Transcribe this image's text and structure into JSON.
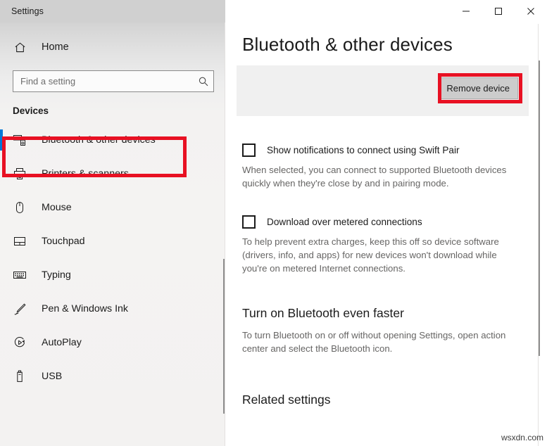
{
  "window": {
    "title": "Settings",
    "controls": [
      {
        "name": "minimize",
        "glyph": "minimize-icon"
      },
      {
        "name": "maximize",
        "glyph": "maximize-icon"
      },
      {
        "name": "close",
        "glyph": "close-icon"
      }
    ]
  },
  "sidebar": {
    "home_label": "Home",
    "home_icon": "home-icon",
    "search": {
      "placeholder": "Find a setting",
      "value": "",
      "icon": "search-icon"
    },
    "group_title": "Devices",
    "items": [
      {
        "label": "Bluetooth & other devices",
        "icon": "bluetooth-devices-icon",
        "selected": true
      },
      {
        "label": "Printers & scanners",
        "icon": "printer-icon",
        "selected": false
      },
      {
        "label": "Mouse",
        "icon": "mouse-icon",
        "selected": false
      },
      {
        "label": "Touchpad",
        "icon": "touchpad-icon",
        "selected": false
      },
      {
        "label": "Typing",
        "icon": "keyboard-icon",
        "selected": false
      },
      {
        "label": "Pen & Windows Ink",
        "icon": "pen-icon",
        "selected": false
      },
      {
        "label": "AutoPlay",
        "icon": "autoplay-icon",
        "selected": false
      },
      {
        "label": "USB",
        "icon": "usb-icon",
        "selected": false
      }
    ]
  },
  "main": {
    "page_title": "Bluetooth & other devices",
    "remove_device_label": "Remove device",
    "options": [
      {
        "label": "Show notifications to connect using Swift Pair",
        "checked": false,
        "description": "When selected, you can connect to supported Bluetooth devices quickly when they're close by and in pairing mode."
      },
      {
        "label": "Download over metered connections",
        "checked": false,
        "description": "To help prevent extra charges, keep this off so device software (drivers, info, and apps) for new devices won't download while you're on metered Internet connections."
      }
    ],
    "faster_section": {
      "heading": "Turn on Bluetooth even faster",
      "description": "To turn Bluetooth on or off without opening Settings, open action center and select the Bluetooth icon."
    },
    "related_settings_heading": "Related settings"
  },
  "annotations": {
    "highlight_color": "#e81123",
    "nav_highlight_target": "Bluetooth & other devices",
    "button_highlight_target": "Remove device"
  },
  "watermark": "wsxdn.com",
  "colors": {
    "accent": "#0078d7",
    "highlight_red": "#e81123",
    "panel_gray": "#f0f0f0",
    "button_gray": "#cccccc"
  }
}
